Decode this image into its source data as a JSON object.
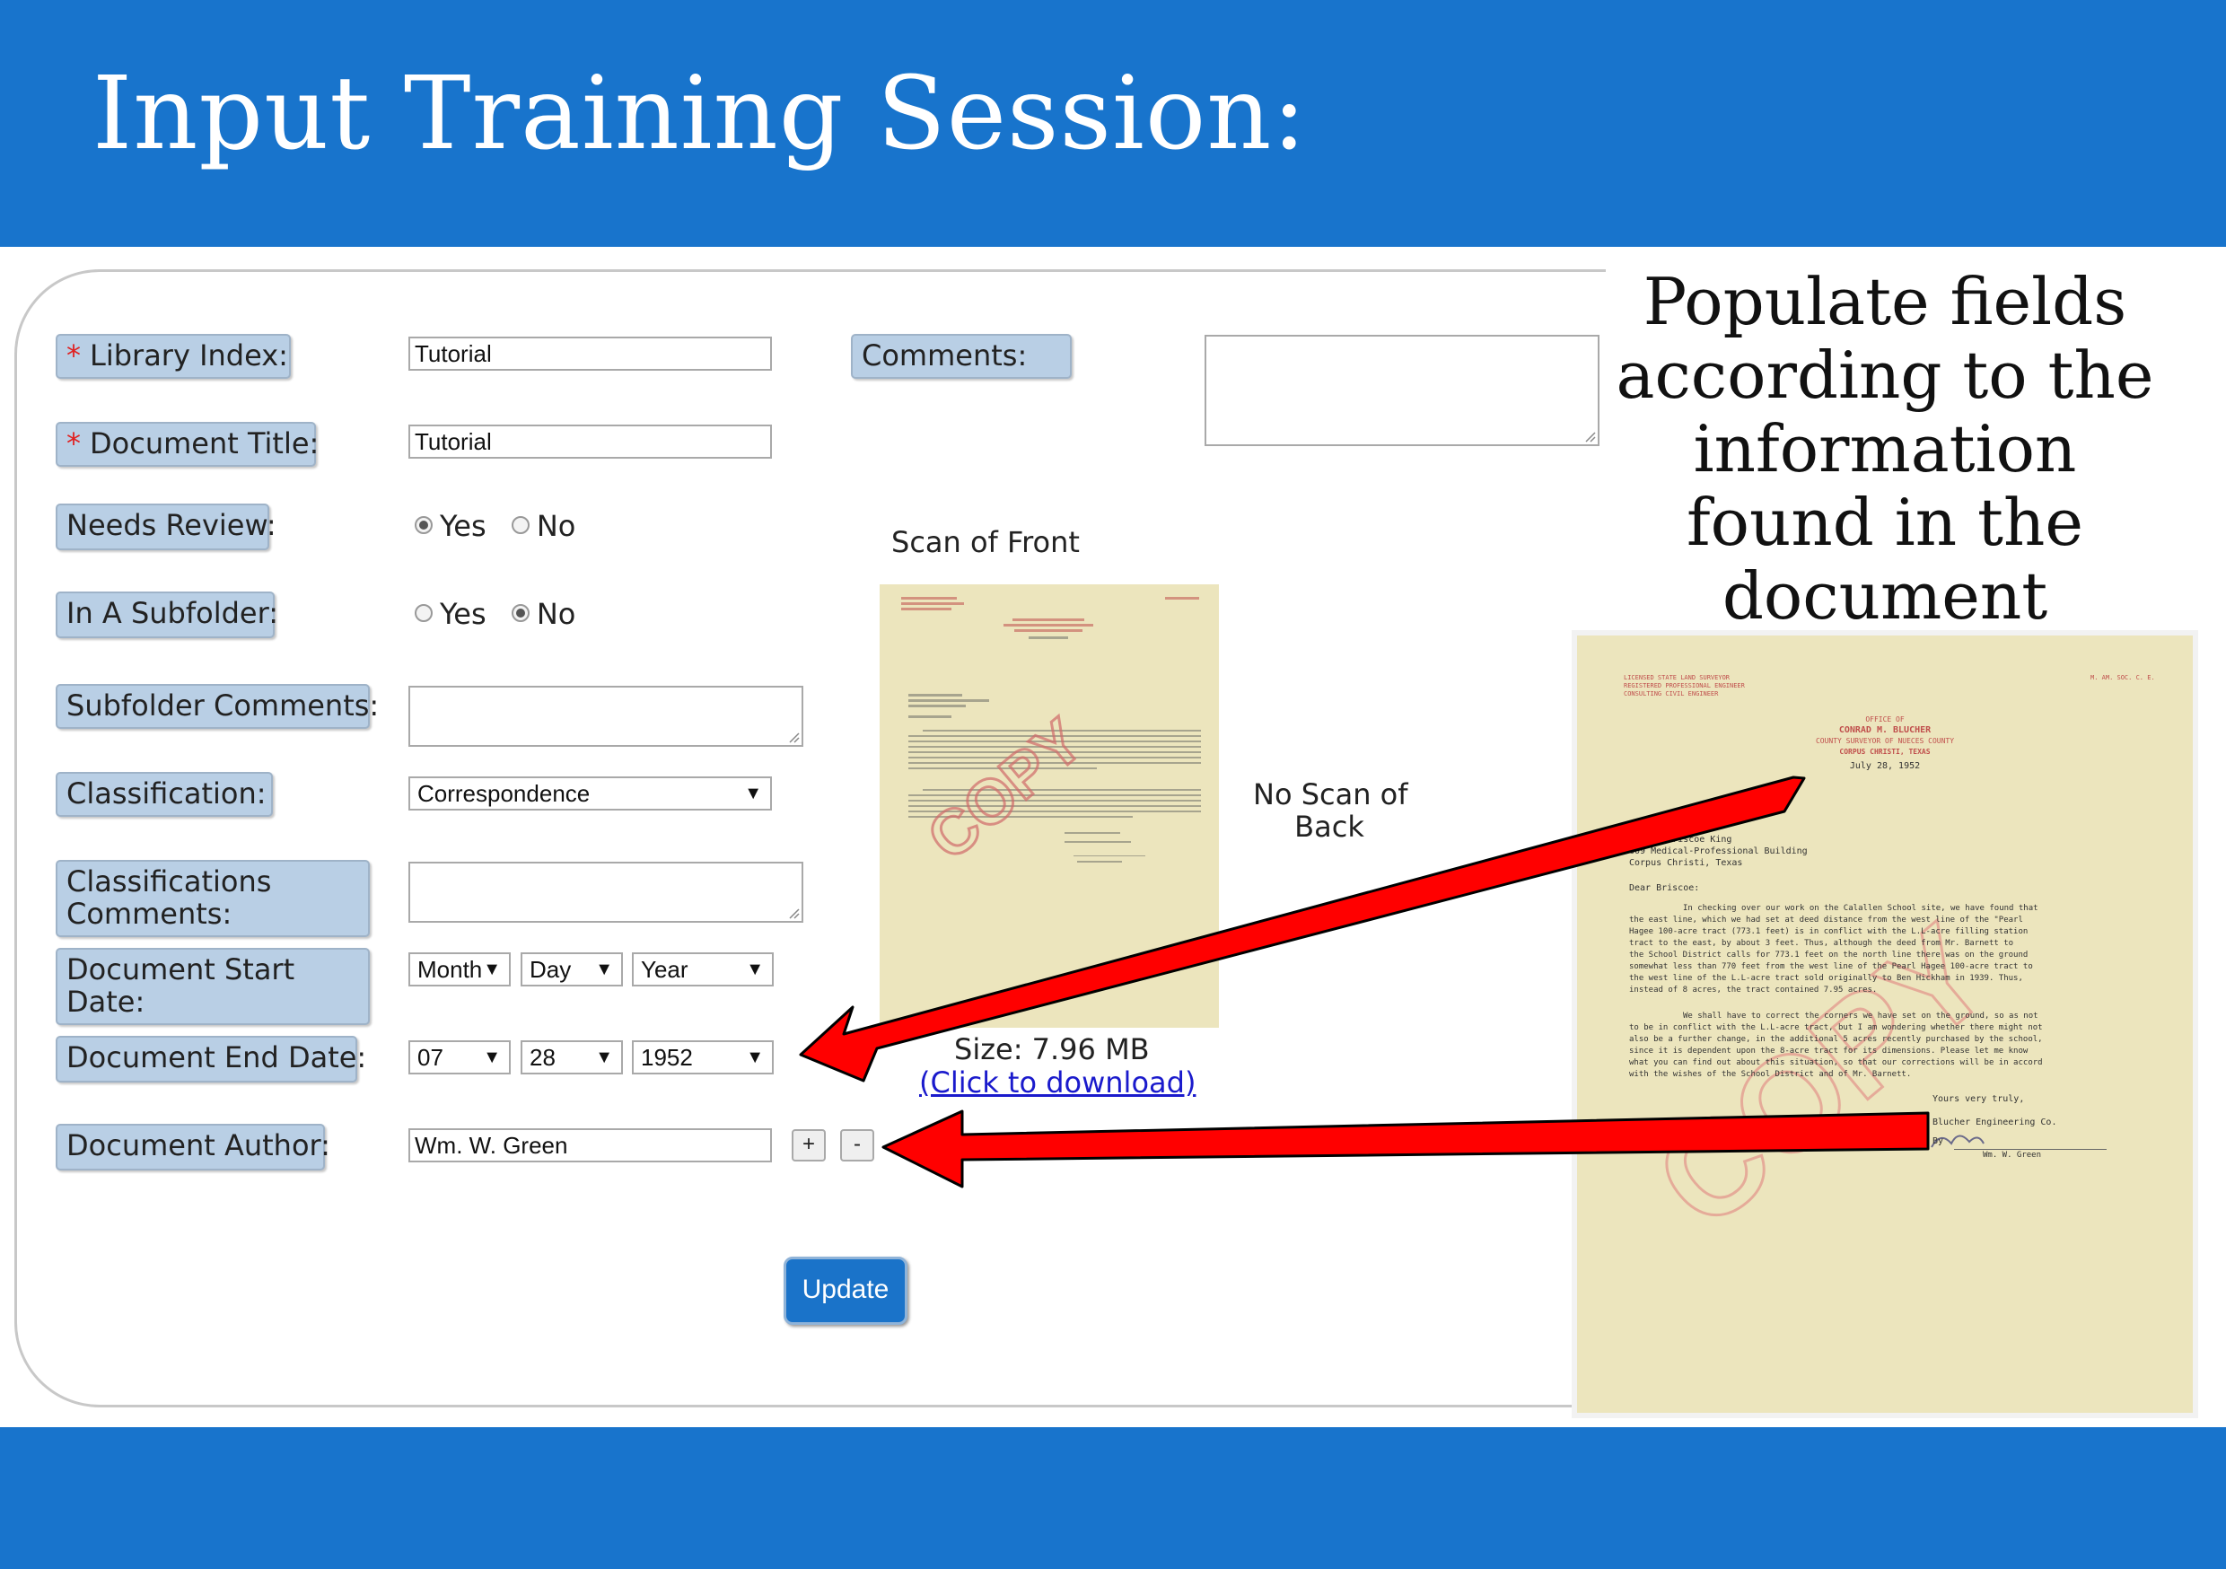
{
  "header": {
    "title": "Input Training Session:"
  },
  "form": {
    "library_index": {
      "label": "Library Index:",
      "required_mark": "*",
      "value": "Tutorial"
    },
    "document_title": {
      "label": "Document Title:",
      "required_mark": "*",
      "value": "Tutorial"
    },
    "needs_review": {
      "label": "Needs Review:",
      "yes": "Yes",
      "no": "No",
      "selected": "Yes"
    },
    "in_subfolder": {
      "label": "In A Subfolder:",
      "yes": "Yes",
      "no": "No",
      "selected": "No"
    },
    "subfolder_comments": {
      "label": "Subfolder Comments:",
      "value": ""
    },
    "classification": {
      "label": "Classification:",
      "value": "Correspondence"
    },
    "classifications_comments": {
      "label": "Classifications Comments:",
      "value": ""
    },
    "start_date": {
      "label": "Document Start Date:",
      "month": "Month",
      "day": "Day",
      "year": "Year"
    },
    "end_date": {
      "label": "Document End Date:",
      "month": "07",
      "day": "28",
      "year": "1952"
    },
    "author": {
      "label": "Document Author:",
      "value": "Wm. W. Green",
      "add": "+",
      "remove": "-"
    },
    "comments": {
      "label": "Comments:",
      "value": ""
    },
    "update_button": "Update"
  },
  "scan": {
    "front_title": "Scan of Front",
    "back_title_line1": "No Scan of",
    "back_title_line2": "Back",
    "size": "Size: 7.96 MB",
    "download": "(Click to download)"
  },
  "note": {
    "lines": [
      "Populate fields",
      "according to the",
      "information",
      "found in the",
      "document"
    ]
  },
  "letter": {
    "left_header": [
      "LICENSED STATE LAND SURVEYOR",
      "REGISTERED PROFESSIONAL ENGINEER",
      "CONSULTING CIVIL ENGINEER"
    ],
    "right_header": "M. AM. SOC. C. E.",
    "office_of": "OFFICE OF",
    "name": "CONRAD M. BLUCHER",
    "subtitle": "COUNTY SURVEYOR OF NUECES COUNTY",
    "city": "CORPUS CHRISTI, TEXAS",
    "date": "July 28, 1952",
    "address": [
      "Mr. H. Briscoe King",
      "609 Medical-Professional Building",
      "Corpus Christi, Texas"
    ],
    "salutation": "Dear Briscoe:",
    "para1": [
      "In checking over our work on the Calallen School site, we have found that",
      "the east line, which we had set at deed distance from the west line of the \"Pearl",
      "Hagee 100-acre tract (773.1 feet) is in conflict with the L.L-acre filling station",
      "tract to the east, by about 3 feet. Thus, although the deed from Mr. Barnett to",
      "the School District calls for 773.1 feet on the north line there was on the ground",
      "somewhat less than 770 feet from the west line of the Pearl Hagee 100-acre tract to",
      "the west line of the L.L-acre tract sold originally to Ben Hickham in 1939. Thus,",
      "instead of 8 acres, the tract contained 7.95 acres."
    ],
    "para2": [
      "We shall have to correct the corners we have set on the ground, so as not",
      "to be in conflict with the L.L-acre tract, but I am wondering whether there might not",
      "also be a further change, in the additional 5 acres recently purchased by the school,",
      "since it is dependent upon the 8-acre tract for its dimensions. Please let me know",
      "what you can find out about this situation, so that our corrections will be in accord",
      "with the wishes of the School District and of Mr. Barnett."
    ],
    "closing": "Yours very truly,",
    "company": "Blucher Engineering Co.",
    "by": "By",
    "signer": "Wm. W. Green",
    "stamp": "COPY"
  }
}
